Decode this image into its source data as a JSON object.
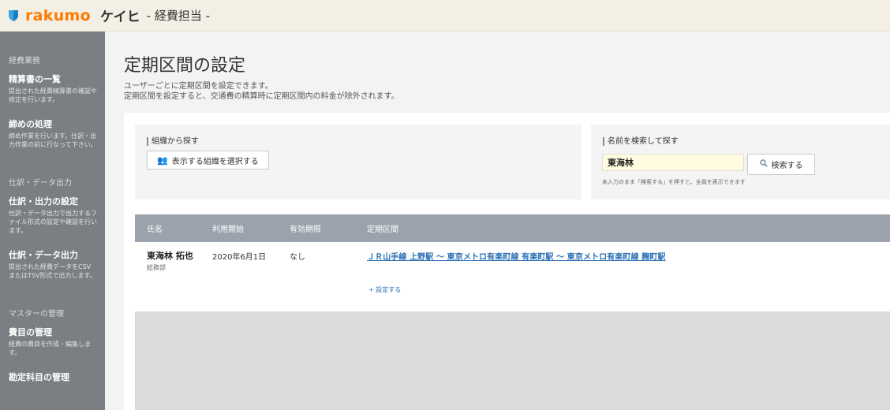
{
  "header": {
    "brand": "rakumo",
    "app_name": "ケイヒ",
    "app_sub": "- 経費担当 -",
    "brand_color": "#ff7a00"
  },
  "sidebar": {
    "sections": [
      {
        "title": "経費業務",
        "items": [
          {
            "title": "精算書の一覧",
            "desc": "提出された経費精算書の確認や修正を行います。"
          },
          {
            "title": "締めの処理",
            "desc": "締め作業を行います。仕訳・出力作業の前に行なって下さい。"
          }
        ]
      },
      {
        "title": "仕訳・データ出力",
        "items": [
          {
            "title": "仕訳・出力の設定",
            "desc": "仕訳・データ出力で出力するファイル形式の設定や確認を行います。"
          },
          {
            "title": "仕訳・データ出力",
            "desc": "提出された経費データをCSVまたはTSV形式で出力します。"
          }
        ]
      },
      {
        "title": "マスターの管理",
        "items": [
          {
            "title": "費目の管理",
            "desc": "経費の費目を作成・編集します。"
          },
          {
            "title": "勘定科目の管理",
            "desc": ""
          }
        ]
      }
    ]
  },
  "page": {
    "title": "定期区間の設定",
    "desc1": "ユーザーごとに定期区間を設定できます。",
    "desc2": "定期区間を設定すると、交通費の精算時に定期区間内の料金が除外されます。"
  },
  "search": {
    "org_label": "組織から探す",
    "org_button": "表示する組織を選択する",
    "name_label": "名前を検索して探す",
    "name_value": "東海林",
    "search_button": "検索する",
    "hint": "未入力のまま「検索する」を押すと、全員を表示できます"
  },
  "table": {
    "headers": [
      "氏名",
      "利用開始",
      "有効期限",
      "定期区間"
    ],
    "rows": [
      {
        "name": "東海林 拓也",
        "dept": "総務部",
        "start": "2020年6月1日",
        "expiry": "なし",
        "route": "ＪＲ山手線 上野駅 〜 東京メトロ有楽町線 有楽町駅 〜 東京メトロ有楽町線 麹町駅",
        "add_label": "+ 設定する"
      }
    ]
  }
}
